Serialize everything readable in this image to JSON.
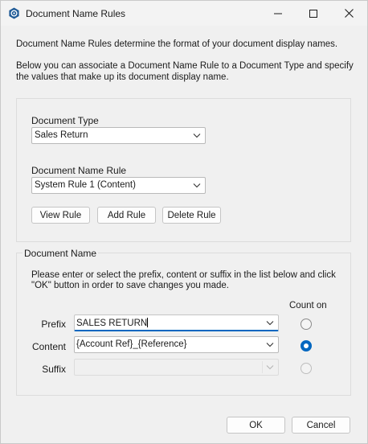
{
  "window": {
    "title": "Document Name Rules",
    "icon": "gear-icon"
  },
  "intro": {
    "line1": "Document Name Rules determine the format of your document display names.",
    "line2": "Below you can associate a Document Name Rule to a Document Type and specify the values that make up its document display name."
  },
  "document_type": {
    "label": "Document Type",
    "value": "Sales Return"
  },
  "document_name_rule": {
    "label": "Document Name Rule",
    "value": "System Rule 1 (Content)"
  },
  "rule_buttons": {
    "view": "View Rule",
    "add": "Add Rule",
    "delete": "Delete Rule"
  },
  "document_name": {
    "group_title": "Document Name",
    "instructions": "Please enter or select the prefix, content or suffix in the list below and click \"OK\" button in order to save changes you made.",
    "count_on_label": "Count on",
    "rows": [
      {
        "label": "Prefix",
        "value": "SALES RETURN",
        "count_on": false
      },
      {
        "label": "Content",
        "value": "{Account Ref}_{Reference}",
        "count_on": true
      },
      {
        "label": "Suffix",
        "value": "",
        "count_on": false,
        "disabled": true
      }
    ]
  },
  "footer": {
    "ok": "OK",
    "cancel": "Cancel"
  },
  "colors": {
    "accent": "#0067c0",
    "background": "#f0f0f0"
  }
}
